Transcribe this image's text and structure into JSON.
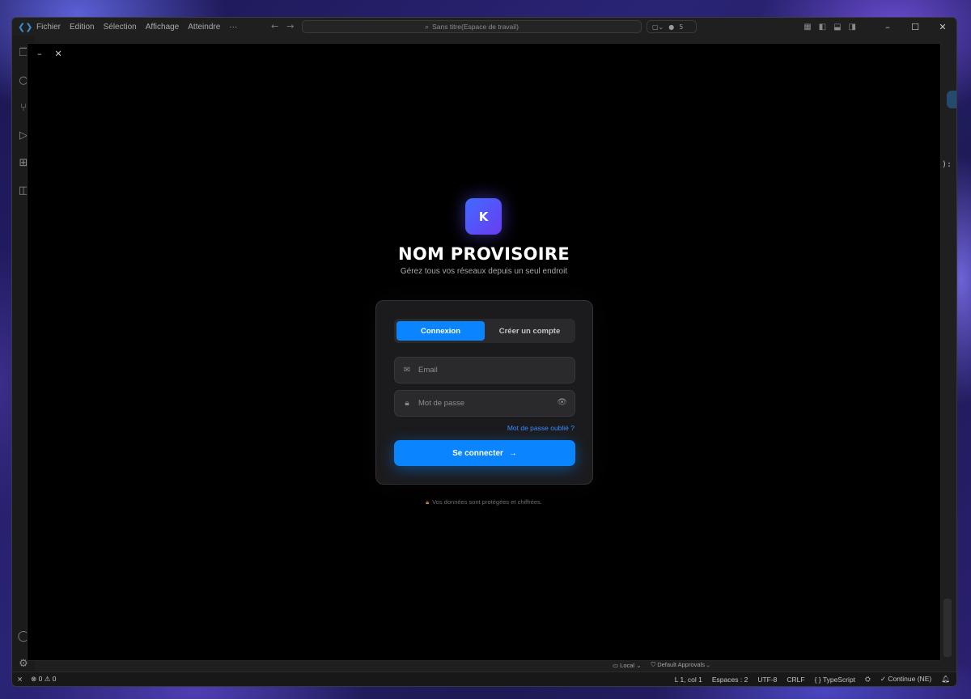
{
  "vscode": {
    "menu": [
      "Fichier",
      "Edition",
      "Sélection",
      "Affichage",
      "Atteindre",
      "···"
    ],
    "command_center": "Sans titre(Espace de travail)",
    "copilot_count": "5",
    "statusbar": {
      "errors": "0",
      "warnings": "0",
      "cursor": "L 1, col 1",
      "spaces": "Espaces : 2",
      "encoding": "UTF-8",
      "eol": "CRLF",
      "language": "TypeScript",
      "continue": "Continue (NE)"
    },
    "under_strip": {
      "local": "Local",
      "approvals": "Default Approvals"
    },
    "right_edge_text": "):"
  },
  "app": {
    "brand": {
      "logo_letter": "K",
      "title": "NOM PROVISOIRE",
      "subtitle": "Gérez tous vos réseaux depuis un seul endroit"
    },
    "tabs": {
      "login": "Connexion",
      "signup": "Créer un compte",
      "active": "login"
    },
    "form": {
      "email_placeholder": "Email",
      "email_value": "",
      "password_placeholder": "Mot de passe",
      "password_value": "",
      "forgot_link": "Mot de passe oublié ?",
      "submit_label": "Se connecter"
    },
    "footer_note": "Vos données sont protégées et chiffrées.",
    "colors": {
      "accent": "#0a84ff",
      "background": "#000000",
      "card": "#1b1b1d"
    }
  }
}
